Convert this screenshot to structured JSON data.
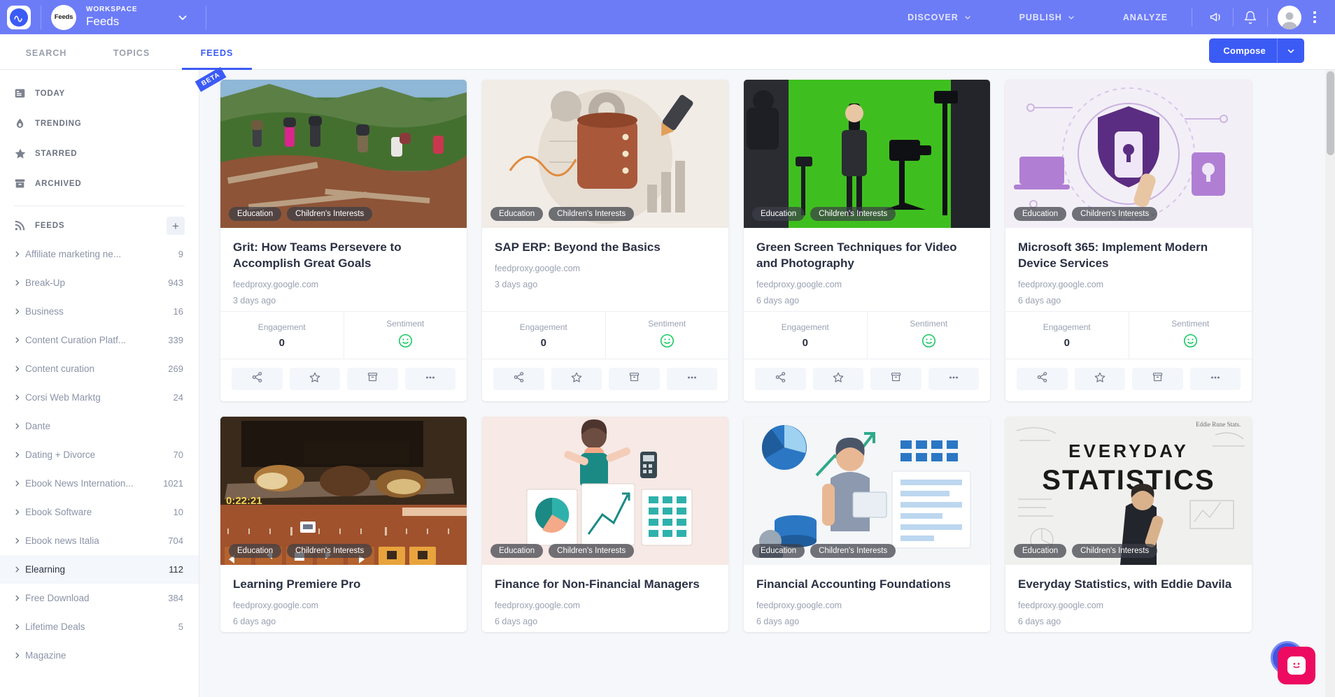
{
  "header": {
    "logo_icon": "app-logo-icon",
    "workspace_label": "WORKSPACE",
    "workspace_name": "Feeds",
    "workspace_avatar_text": "Feeds",
    "caret_icon": "chevron-down-icon",
    "nav": [
      {
        "label": "DISCOVER",
        "has_caret": true
      },
      {
        "label": "PUBLISH",
        "has_caret": true
      },
      {
        "label": "ANALYZE",
        "has_caret": false
      }
    ],
    "megaphone_icon": "megaphone-icon",
    "bell_icon": "bell-icon",
    "avatar_icon": "user-avatar-icon",
    "kebab_icon": "more-vertical-icon"
  },
  "tabs": {
    "items": [
      {
        "label": "SEARCH",
        "active": false
      },
      {
        "label": "TOPICS",
        "active": false
      },
      {
        "label": "FEEDS",
        "active": true
      }
    ],
    "beta_badge": "BETA",
    "compose_label": "Compose",
    "compose_caret_icon": "chevron-down-icon"
  },
  "sidebar": {
    "nav": [
      {
        "label": "TODAY",
        "icon": "today-list-icon"
      },
      {
        "label": "TRENDING",
        "icon": "flame-icon"
      },
      {
        "label": "STARRED",
        "icon": "star-icon"
      },
      {
        "label": "ARCHIVED",
        "icon": "archive-icon"
      }
    ],
    "feeds_section": {
      "label": "FEEDS",
      "icon": "rss-icon",
      "add_icon": "plus-icon"
    },
    "feeds": [
      {
        "name": "Affiliate marketing ne...",
        "count": "9",
        "active": false
      },
      {
        "name": "Break-Up",
        "count": "943",
        "active": false
      },
      {
        "name": "Business",
        "count": "16",
        "active": false
      },
      {
        "name": "Content Curation Platf...",
        "count": "339",
        "active": false
      },
      {
        "name": "Content curation",
        "count": "269",
        "active": false
      },
      {
        "name": "Corsi Web Marktg",
        "count": "24",
        "active": false
      },
      {
        "name": "Dante",
        "count": "",
        "active": false
      },
      {
        "name": "Dating + Divorce",
        "count": "70",
        "active": false
      },
      {
        "name": "Ebook News Internation...",
        "count": "1021",
        "active": false
      },
      {
        "name": "Ebook Software",
        "count": "10",
        "active": false
      },
      {
        "name": "Ebook news Italia",
        "count": "704",
        "active": false
      },
      {
        "name": "Elearning",
        "count": "112",
        "active": true
      },
      {
        "name": "Free Download",
        "count": "384",
        "active": false
      },
      {
        "name": "Lifetime Deals",
        "count": "5",
        "active": false
      },
      {
        "name": "Magazine",
        "count": "",
        "active": false
      }
    ]
  },
  "cards": [
    {
      "title": "Grit: How Teams Persevere to Accomplish Great Goals",
      "source": "feedproxy.google.com",
      "time": "3 days ago",
      "tags": [
        "Education",
        "Children's Interests"
      ],
      "engagement_label": "Engagement",
      "engagement_value": "0",
      "sentiment_label": "Sentiment",
      "sentiment_icon": "smiley-face-icon",
      "sentiment_color": "#17c964",
      "image_kind": "hikers-mountain-photo"
    },
    {
      "title": "SAP ERP: Beyond the Basics",
      "source": "feedproxy.google.com",
      "time": "3 days ago",
      "tags": [
        "Education",
        "Children's Interests"
      ],
      "engagement_label": "Engagement",
      "engagement_value": "0",
      "sentiment_label": "Sentiment",
      "sentiment_icon": "smiley-face-icon",
      "sentiment_color": "#17c964",
      "image_kind": "database-illustration"
    },
    {
      "title": "Green Screen Techniques for Video and Photography",
      "source": "feedproxy.google.com",
      "time": "6 days ago",
      "tags": [
        "Education",
        "Children's Interests"
      ],
      "engagement_label": "Engagement",
      "engagement_value": "0",
      "sentiment_label": "Sentiment",
      "sentiment_icon": "smiley-face-icon",
      "sentiment_color": "#17c964",
      "image_kind": "green-screen-studio-photo"
    },
    {
      "title": "Microsoft 365: Implement Modern Device Services",
      "source": "feedproxy.google.com",
      "time": "6 days ago",
      "tags": [
        "Education",
        "Children's Interests"
      ],
      "engagement_label": "Engagement",
      "engagement_value": "0",
      "sentiment_label": "Sentiment",
      "sentiment_icon": "smiley-face-icon",
      "sentiment_color": "#17c964",
      "image_kind": "security-shield-illustration"
    },
    {
      "title": "Learning Premiere Pro",
      "source": "feedproxy.google.com",
      "time": "6 days ago",
      "tags": [
        "Education",
        "Children's Interests"
      ],
      "video_timecode": "0:22:21",
      "image_kind": "video-editor-bread-photo"
    },
    {
      "title": "Finance for Non-Financial Managers",
      "source": "feedproxy.google.com",
      "time": "6 days ago",
      "tags": [
        "Education",
        "Children's Interests"
      ],
      "image_kind": "presenter-charts-illustration"
    },
    {
      "title": "Financial Accounting Foundations",
      "source": "feedproxy.google.com",
      "time": "6 days ago",
      "tags": [
        "Education",
        "Children's Interests"
      ],
      "image_kind": "accounting-illustration"
    },
    {
      "title": "Everyday Statistics, with Eddie Davila",
      "source": "feedproxy.google.com",
      "time": "6 days ago",
      "tags": [
        "Education",
        "Children's Interests"
      ],
      "overlay_text_line1": "EVERYDAY",
      "overlay_text_line2": "STATISTICS",
      "image_kind": "whiteboard-statistics-photo"
    }
  ],
  "card_actions": [
    {
      "icon": "share-icon",
      "name": "share-button"
    },
    {
      "icon": "star-icon",
      "name": "star-button"
    },
    {
      "icon": "archive-icon",
      "name": "archive-button"
    },
    {
      "icon": "more-horizontal-icon",
      "name": "more-button"
    }
  ],
  "chat": {
    "icon": "chat-smiley-icon",
    "color": "#ec0b61"
  },
  "colors": {
    "header_bg": "#6c7cf7",
    "accent": "#3b5bf5",
    "page_bg": "#f5f7fa"
  }
}
